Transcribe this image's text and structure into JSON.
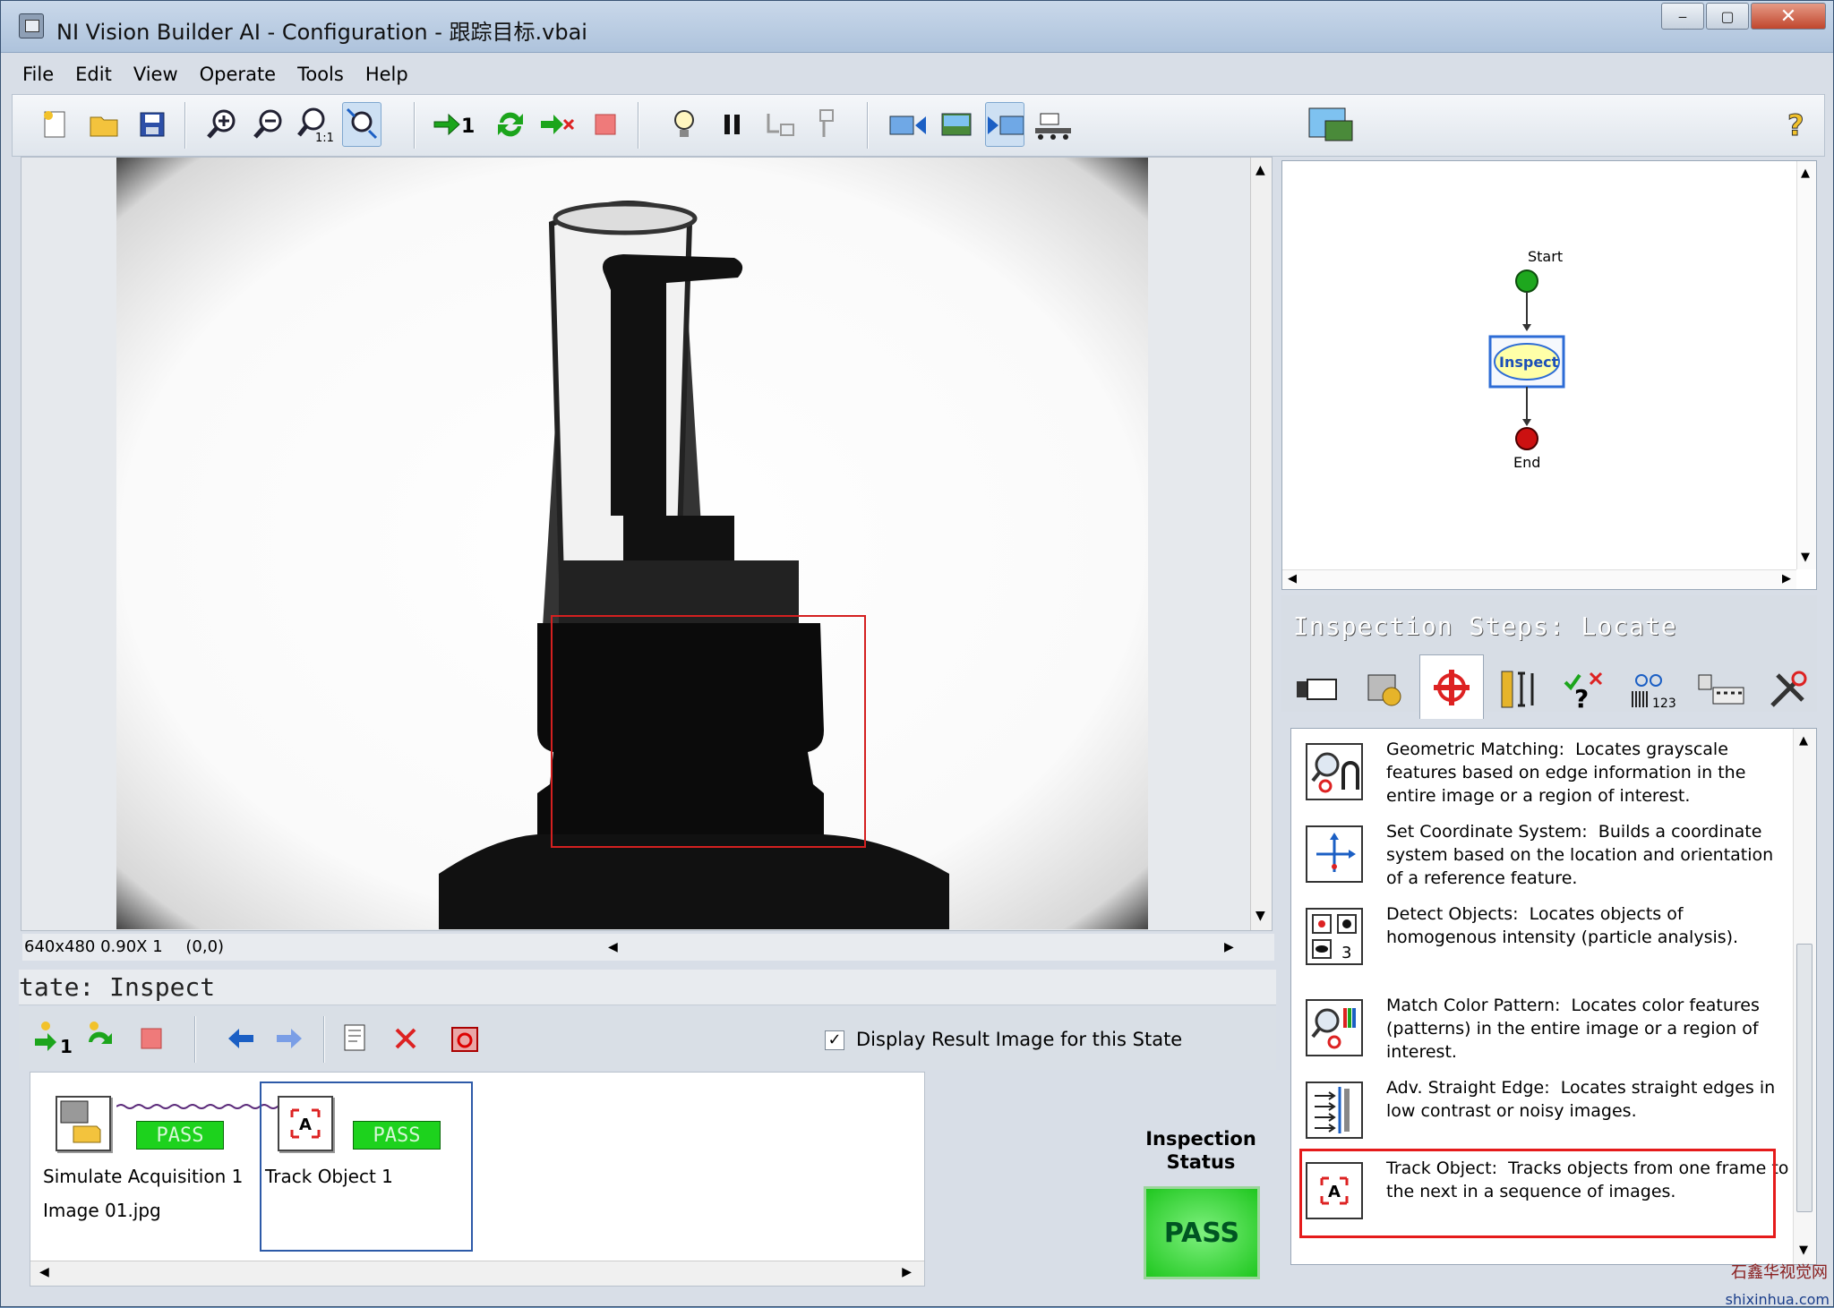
{
  "window": {
    "title": "NI Vision Builder AI - Configuration - 跟踪目标.vbai"
  },
  "menu": [
    "File",
    "Edit",
    "View",
    "Operate",
    "Tools",
    "Help"
  ],
  "toolbar": {
    "icons": [
      "new-file-icon",
      "open-folder-icon",
      "save-icon",
      "zoom-in-icon",
      "zoom-out-icon",
      "zoom-1-1-icon",
      "zoom-fit-icon",
      "run-once-icon",
      "run-continuous-icon",
      "run-stop-on-fail-icon",
      "stop-icon",
      "highlight-icon",
      "pause-icon",
      "step-icon",
      "step-over-icon",
      "image-left-icon",
      "image-icon",
      "image-right-icon",
      "conveyor-icon",
      "config-icon",
      "help-icon"
    ]
  },
  "image_status": {
    "info": "640x480 0.90X 1",
    "coords": "(0,0)"
  },
  "state": {
    "header": "tate:  Inspect",
    "display_result_label": "Display Result Image for this State",
    "display_result_checked": true
  },
  "steps": [
    {
      "name": "Simulate Acquisition 1",
      "sub": "Image 01.jpg",
      "status": "PASS"
    },
    {
      "name": "Track Object 1",
      "sub": "",
      "status": "PASS"
    }
  ],
  "inspection_status": {
    "label_1": "Inspection",
    "label_2": "Status",
    "value": "PASS"
  },
  "flow": {
    "start": "Start",
    "node": "Inspect",
    "end": "End"
  },
  "inspection_steps": {
    "header": "Inspection Steps: Locate",
    "items": [
      {
        "title": "Geometric Matching:",
        "desc": "Locates grayscale features based on edge information in the entire image or a region of interest.",
        "icon": "geometric-matching-icon"
      },
      {
        "title": "Set Coordinate System:",
        "desc": "Builds a coordinate system based on the location and orientation of a reference feature.",
        "icon": "coordinate-system-icon"
      },
      {
        "title": "Detect Objects:",
        "desc": "Locates objects of homogenous intensity (particle analysis).",
        "icon": "detect-objects-icon"
      },
      {
        "title": "Match Color Pattern:",
        "desc": "Locates color features (patterns) in the entire image or a region of interest.",
        "icon": "match-color-icon"
      },
      {
        "title": "Adv. Straight Edge:",
        "desc": "Locates straight edges in low contrast or noisy images.",
        "icon": "straight-edge-icon"
      },
      {
        "title": "Track Object:",
        "desc": "Tracks objects from one frame to the next in a sequence of images.",
        "icon": "track-object-icon"
      }
    ]
  },
  "colors": {
    "pass": "#1dd21d",
    "highlight": "#e51b1b",
    "roi": "#d42020"
  },
  "watermark": {
    "line1": "石鑫华视觉网",
    "line2": "shixinhua.com"
  }
}
